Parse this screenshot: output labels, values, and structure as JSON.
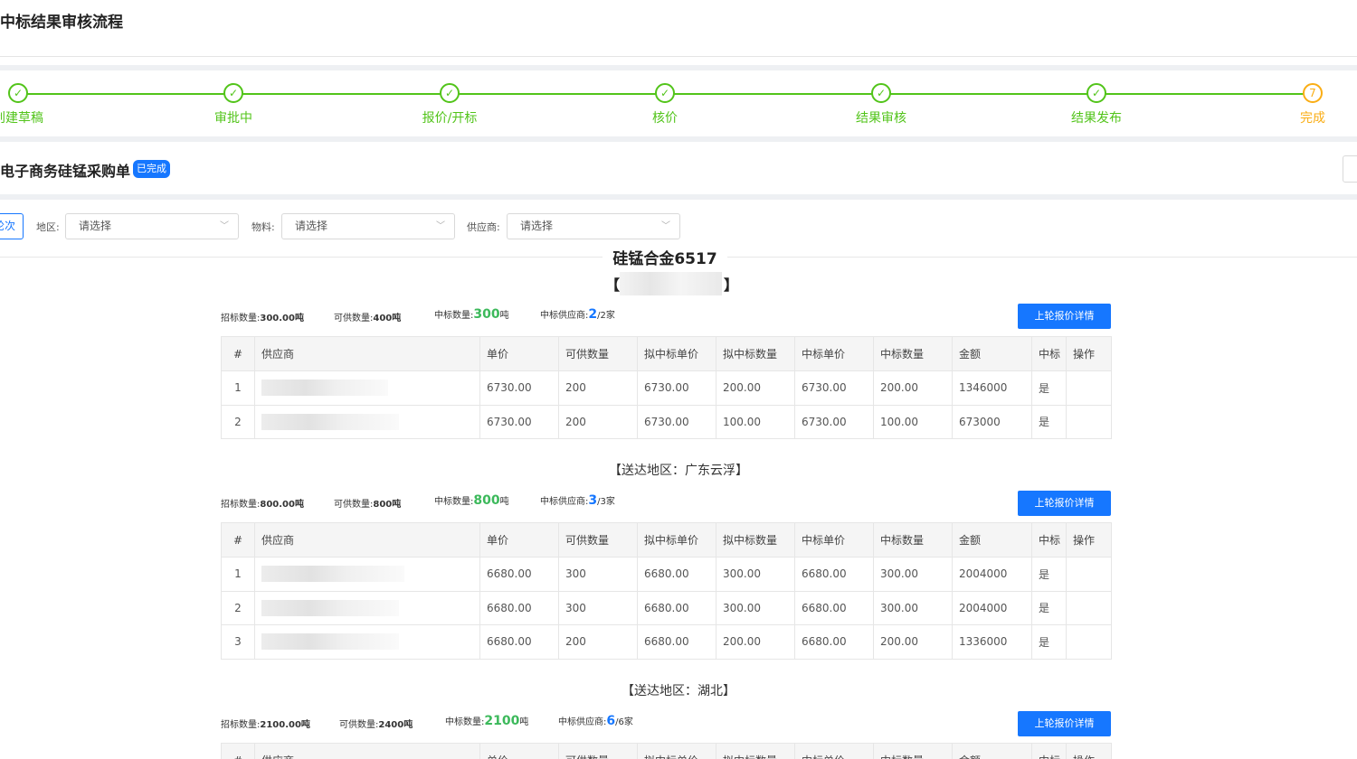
{
  "page_title": "中标结果审核流程",
  "steps": [
    {
      "label": "创建草稿",
      "mark": "✓",
      "current": false
    },
    {
      "label": "审批中",
      "mark": "✓",
      "current": false
    },
    {
      "label": "报价/开标",
      "mark": "✓",
      "current": false
    },
    {
      "label": "核价",
      "mark": "✓",
      "current": false
    },
    {
      "label": "结果审核",
      "mark": "✓",
      "current": false
    },
    {
      "label": "结果发布",
      "mark": "✓",
      "current": false
    },
    {
      "label": "完成",
      "mark": "7",
      "current": true
    }
  ],
  "order": {
    "title": "电子商务硅锰采购单",
    "status_badge": "已完成"
  },
  "filters": {
    "round_button": "轮次",
    "region_label": "地区:",
    "region_placeholder": "请选择",
    "material_label": "物料:",
    "material_placeholder": "请选择",
    "supplier_label": "供应商:",
    "supplier_placeholder": "请选择"
  },
  "material_title": "硅锰合金6517",
  "columns": [
    "#",
    "供应商",
    "单价",
    "可供数量",
    "拟中标单价",
    "拟中标数量",
    "中标单价",
    "中标数量",
    "金额",
    "中标",
    "操作"
  ],
  "groups": [
    {
      "region": "【】",
      "summary": {
        "tender_label": "招标数量:",
        "tender_value": "300.00吨",
        "supply_label": "可供数量:",
        "supply_value": "400吨",
        "won_label": "中标数量:",
        "won_value": "300",
        "won_unit": "吨",
        "sup_label": "中标供应商:",
        "sup_value": "2",
        "sup_total": "/2家"
      },
      "detail_button": "上轮报价详情",
      "rows": [
        [
          "1",
          "",
          "6730.00",
          "200",
          "6730.00",
          "200.00",
          "6730.00",
          "200.00",
          "1346000",
          "是",
          ""
        ],
        [
          "2",
          "",
          "6730.00",
          "200",
          "6730.00",
          "100.00",
          "6730.00",
          "100.00",
          "673000",
          "是",
          ""
        ]
      ]
    },
    {
      "region": "【送达地区：广东云浮】",
      "summary": {
        "tender_label": "招标数量:",
        "tender_value": "800.00吨",
        "supply_label": "可供数量:",
        "supply_value": "800吨",
        "won_label": "中标数量:",
        "won_value": "800",
        "won_unit": "吨",
        "sup_label": "中标供应商:",
        "sup_value": "3",
        "sup_total": "/3家"
      },
      "detail_button": "上轮报价详情",
      "rows": [
        [
          "1",
          "",
          "6680.00",
          "300",
          "6680.00",
          "300.00",
          "6680.00",
          "300.00",
          "2004000",
          "是",
          ""
        ],
        [
          "2",
          "",
          "6680.00",
          "300",
          "6680.00",
          "300.00",
          "6680.00",
          "300.00",
          "2004000",
          "是",
          ""
        ],
        [
          "3",
          "",
          "6680.00",
          "200",
          "6680.00",
          "200.00",
          "6680.00",
          "200.00",
          "1336000",
          "是",
          ""
        ]
      ]
    },
    {
      "region": "【送达地区：湖北】",
      "summary": {
        "tender_label": "招标数量:",
        "tender_value": "2100.00吨",
        "supply_label": "可供数量:",
        "supply_value": "2400吨",
        "won_label": "中标数量:",
        "won_value": "2100",
        "won_unit": "吨",
        "sup_label": "中标供应商:",
        "sup_value": "6",
        "sup_total": "/6家"
      },
      "detail_button": "上轮报价详情",
      "rows": []
    }
  ]
}
